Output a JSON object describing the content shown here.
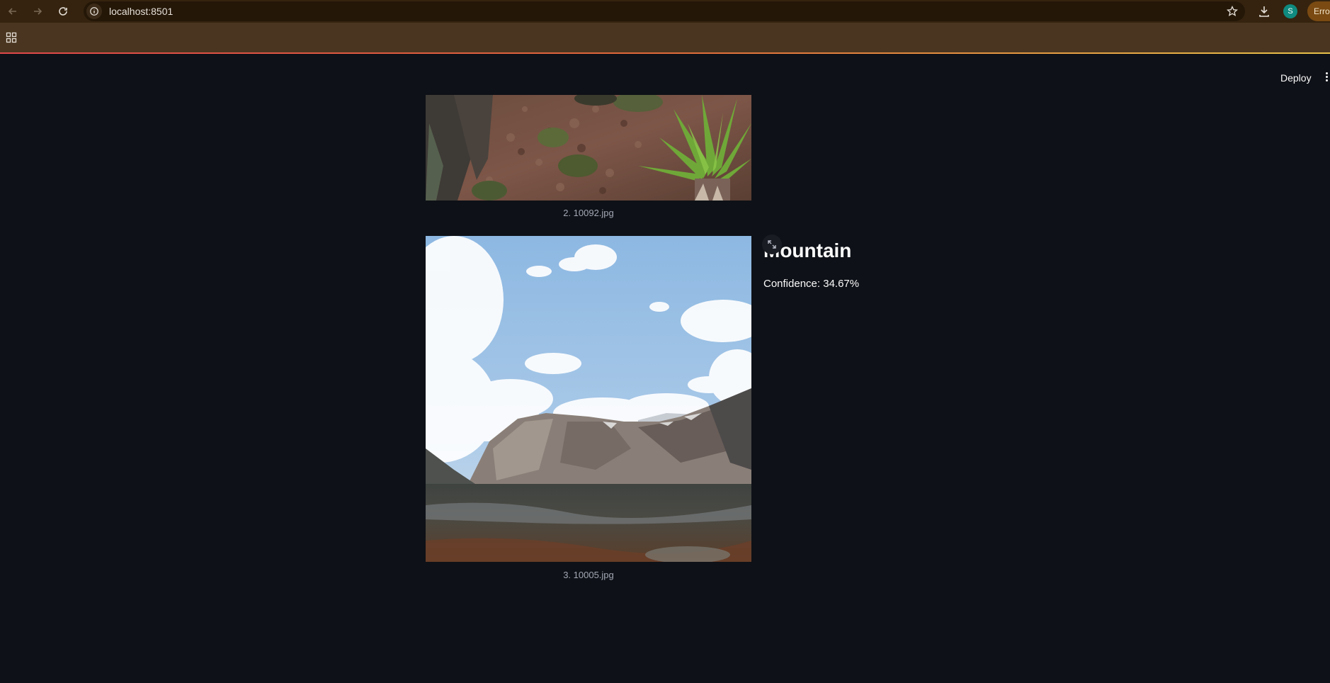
{
  "browser": {
    "url": "localhost:8501",
    "profile_initial": "S",
    "error_chip": "Erro"
  },
  "app": {
    "deploy_label": "Deploy"
  },
  "results": [
    {
      "caption": "2. 10092.jpg"
    },
    {
      "caption": "3. 10005.jpg",
      "label": "Mountain",
      "confidence": "Confidence: 34.67%"
    }
  ]
}
